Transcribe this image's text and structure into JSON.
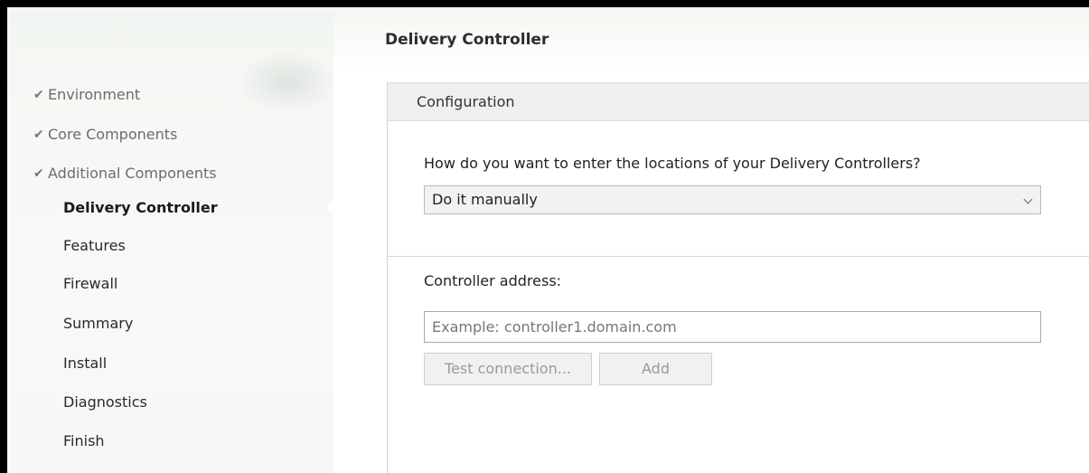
{
  "sidebar": {
    "items": [
      {
        "label": "Environment",
        "status": "done",
        "icon": "check-icon"
      },
      {
        "label": "Core Components",
        "status": "done",
        "icon": "check-icon"
      },
      {
        "label": "Additional Components",
        "status": "done",
        "icon": "check-icon"
      },
      {
        "label": "Delivery Controller",
        "status": "active"
      },
      {
        "label": "Features",
        "status": "pending"
      },
      {
        "label": "Firewall",
        "status": "pending"
      },
      {
        "label": "Summary",
        "status": "pending"
      },
      {
        "label": "Install",
        "status": "pending"
      },
      {
        "label": "Diagnostics",
        "status": "pending"
      },
      {
        "label": "Finish",
        "status": "pending"
      }
    ],
    "check_glyph": "✔"
  },
  "main": {
    "title": "Delivery Controller",
    "panel": {
      "header": "Configuration",
      "question": "How do you want to enter the locations of your Delivery Controllers?",
      "method_select": {
        "selected": "Do it manually",
        "icon": "chevron-down-icon"
      },
      "address_label": "Controller address:",
      "address_input": {
        "value": "",
        "placeholder": "Example: controller1.domain.com"
      },
      "buttons": {
        "test_label": "Test connection...",
        "add_label": "Add"
      }
    }
  }
}
